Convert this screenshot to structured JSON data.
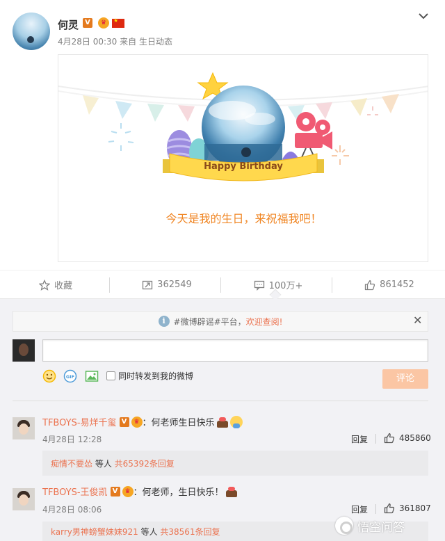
{
  "post": {
    "author": "何灵",
    "verified_icon": "verified-v-badge",
    "member_icon": "crown-member-icon",
    "flag_icon": "china-flag-icon",
    "time": "4月28日 00:30",
    "source_prefix": "来自",
    "source": "生日动态",
    "card": {
      "banner_text": "Happy Birthday",
      "wish_text": "今天是我的生日，来祝福我吧！"
    }
  },
  "actions": {
    "favorite_label": "收藏",
    "repost_count": "362549",
    "comment_count": "100万+",
    "like_count": "861452"
  },
  "notice": {
    "prefix": "#微博辟谣#平台，",
    "link": "欢迎查阅!"
  },
  "composer": {
    "input_value": "",
    "repost_label": "同时转发到我的微博",
    "submit_label": "评论"
  },
  "comments": [
    {
      "user": "TFBOYS-易烊千玺",
      "text": "：何老师生日快乐",
      "time": "4月28日 12:28",
      "reply_label": "回复",
      "likes": "485860",
      "sub_user": "痴情不要怂",
      "sub_mid": " 等人 ",
      "sub_count": "共65392条回复"
    },
    {
      "user": "TFBOYS-王俊凯",
      "text": "：何老师，生日快乐！",
      "time": "4月28日 08:06",
      "reply_label": "回复",
      "likes": "361807",
      "sub_user": "karry男神螃蟹妹妹921",
      "sub_mid": " 等人 ",
      "sub_count": "共38561条回复"
    }
  ],
  "watermark": {
    "text": "悟空问答"
  },
  "colors": {
    "accent": "#eb7350",
    "wish": "#f08624",
    "submit": "#fbc6a4"
  }
}
